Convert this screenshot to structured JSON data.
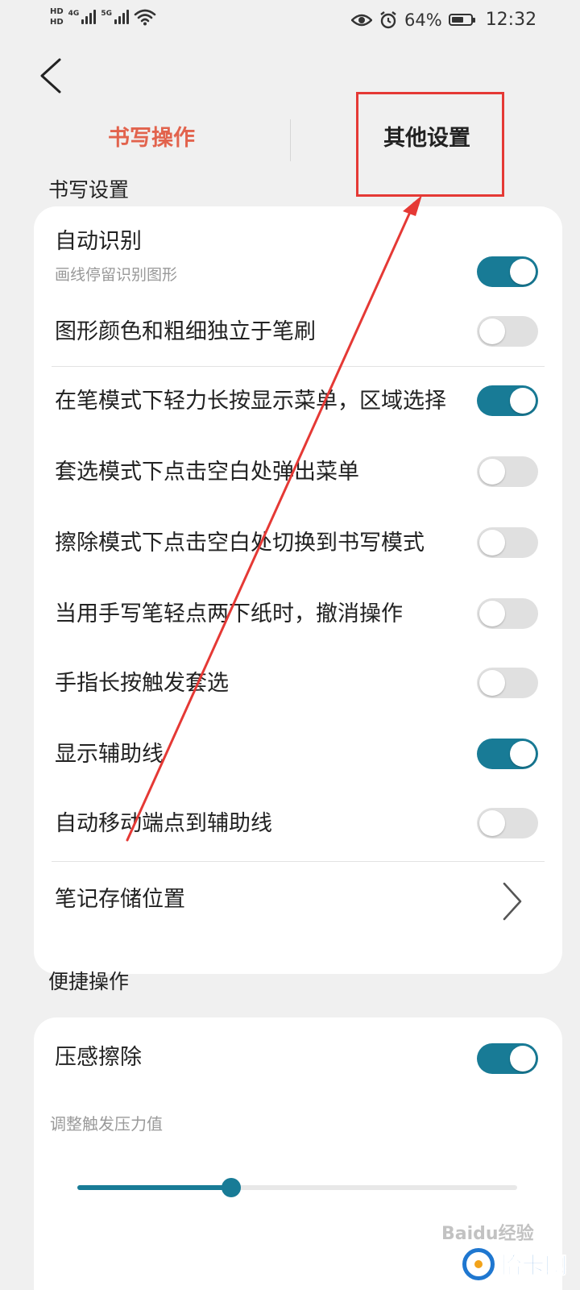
{
  "status_bar": {
    "hd1": "HD",
    "hd2": "HD",
    "net1": "4G",
    "net2": "5G",
    "battery_text": "64%",
    "battery_level": 0.64,
    "time": "12:32",
    "icons": [
      "wifi-icon",
      "eye-icon",
      "alarm-icon",
      "battery-icon"
    ]
  },
  "tabs": [
    {
      "label": "书写操作",
      "active": true
    },
    {
      "label": "其他设置",
      "active": false
    }
  ],
  "sections": {
    "writing_title": "书写设置",
    "quick_title": "便捷操作"
  },
  "writing_settings": [
    {
      "label": "自动识别",
      "sub": "画线停留识别图形",
      "on": true
    },
    {
      "label": "图形颜色和粗细独立于笔刷",
      "on": false
    },
    {
      "label": "在笔模式下轻力长按显示菜单，区域选择",
      "on": true
    },
    {
      "label": "套选模式下点击空白处弹出菜单",
      "on": false
    },
    {
      "label": "擦除模式下点击空白处切换到书写模式",
      "on": false
    },
    {
      "label": "当用手写笔轻点两下纸时，撤消操作",
      "on": false
    },
    {
      "label": "手指长按触发套选",
      "on": false
    },
    {
      "label": "显示辅助线",
      "on": true
    },
    {
      "label": "自动移动端点到辅助线",
      "on": false
    }
  ],
  "storage": {
    "label": "笔记存储位置"
  },
  "quick_ops": {
    "pressure_erase_label": "压感擦除",
    "pressure_erase_on": true,
    "slider_label": "调整触发压力值",
    "slider_value": 0.35
  },
  "watermark": {
    "baidu": "Baiду经验",
    "logo_text": "恰卡网"
  },
  "colors": {
    "accent": "#187b96",
    "active_tab": "#e2634d",
    "annotation": "#e53935"
  }
}
